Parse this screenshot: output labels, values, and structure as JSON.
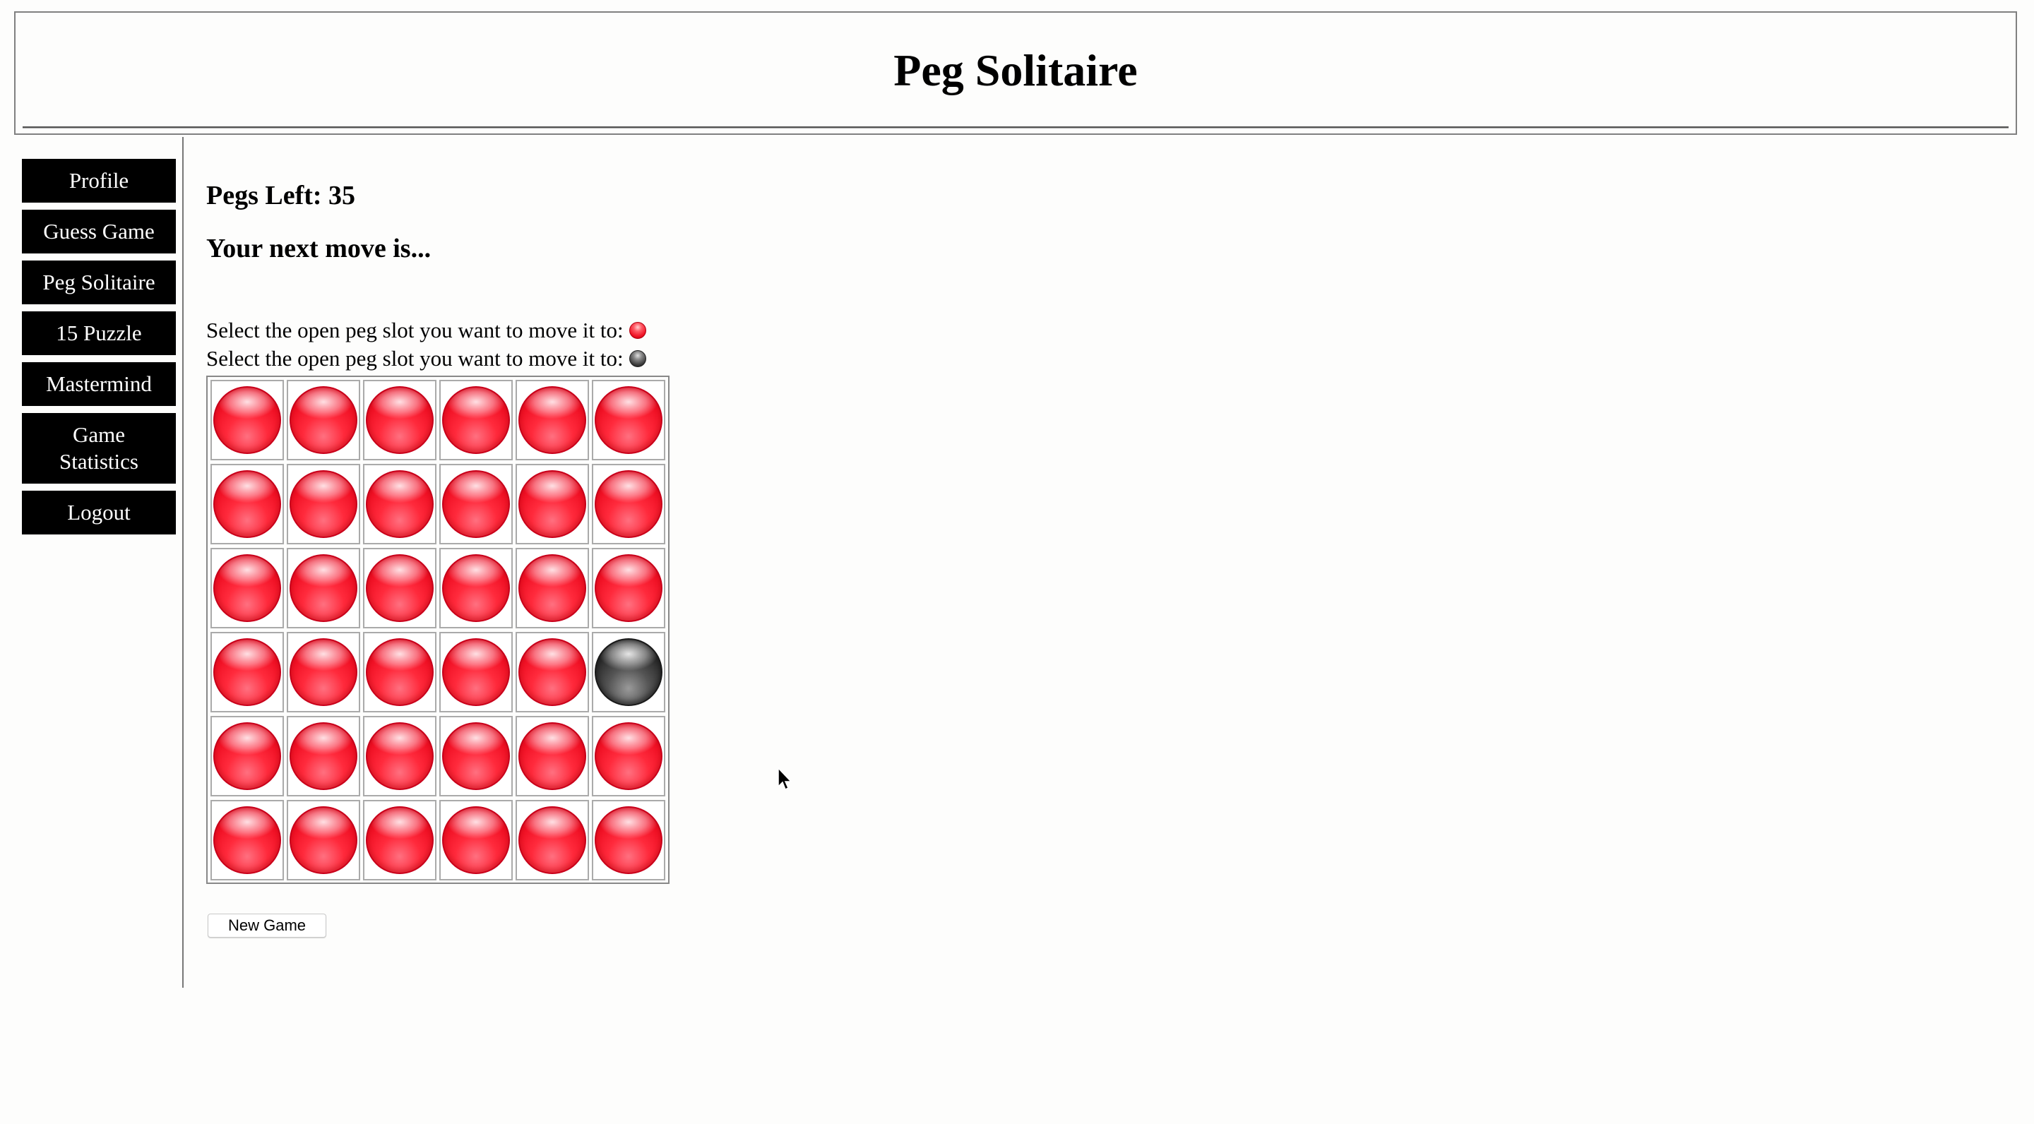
{
  "header": {
    "title": "Peg Solitaire"
  },
  "sidebar": {
    "items": [
      {
        "label": "Profile"
      },
      {
        "label": "Guess Game"
      },
      {
        "label": "Peg Solitaire"
      },
      {
        "label": "15 Puzzle"
      },
      {
        "label": "Mastermind"
      },
      {
        "label": "Game Statistics"
      },
      {
        "label": "Logout"
      }
    ]
  },
  "game": {
    "pegs_left_label": "Pegs Left: 35",
    "next_move_label": "Your next move is...",
    "instruction_red": "Select the open peg slot you want to move it to:",
    "instruction_black": "Select the open peg slot you want to move it to:",
    "new_game_label": "New Game",
    "board": [
      [
        "red",
        "red",
        "red",
        "red",
        "red",
        "red"
      ],
      [
        "red",
        "red",
        "red",
        "red",
        "red",
        "red"
      ],
      [
        "red",
        "red",
        "red",
        "red",
        "red",
        "red"
      ],
      [
        "red",
        "red",
        "red",
        "red",
        "red",
        "black"
      ],
      [
        "red",
        "red",
        "red",
        "red",
        "red",
        "red"
      ],
      [
        "red",
        "red",
        "red",
        "red",
        "red",
        "red"
      ]
    ]
  },
  "colors": {
    "peg_red": "#f01024",
    "peg_black": "#2c2c2c",
    "nav_bg": "#000000",
    "nav_text": "#ffffff"
  }
}
